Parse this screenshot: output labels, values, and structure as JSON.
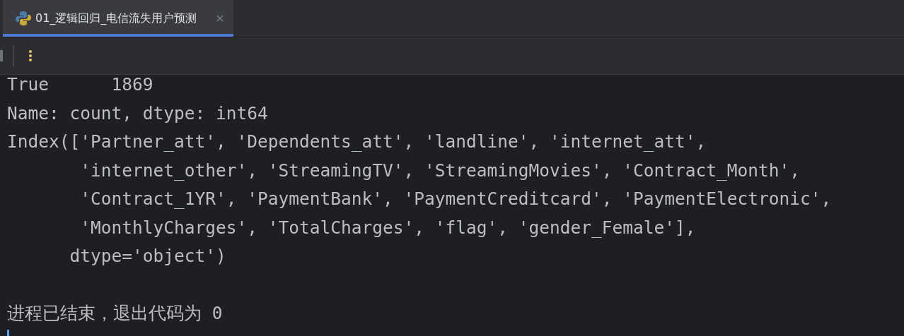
{
  "tabs": [
    {
      "label": "01_逻辑回归_电信流失用户预测",
      "selected": true
    }
  ],
  "console": {
    "lines": [
      "True      1869",
      "Name: count, dtype: int64",
      "Index(['Partner_att', 'Dependents_att', 'landline', 'internet_att',",
      "       'internet_other', 'StreamingTV', 'StreamingMovies', 'Contract_Month',",
      "       'Contract_1YR', 'PaymentBank', 'PaymentCreditcard', 'PaymentElectronic',",
      "       'MonthlyCharges', 'TotalCharges', 'flag', 'gender_Female'],",
      "      dtype='object')"
    ],
    "exit_message": "进程已结束，退出代码为 0"
  }
}
